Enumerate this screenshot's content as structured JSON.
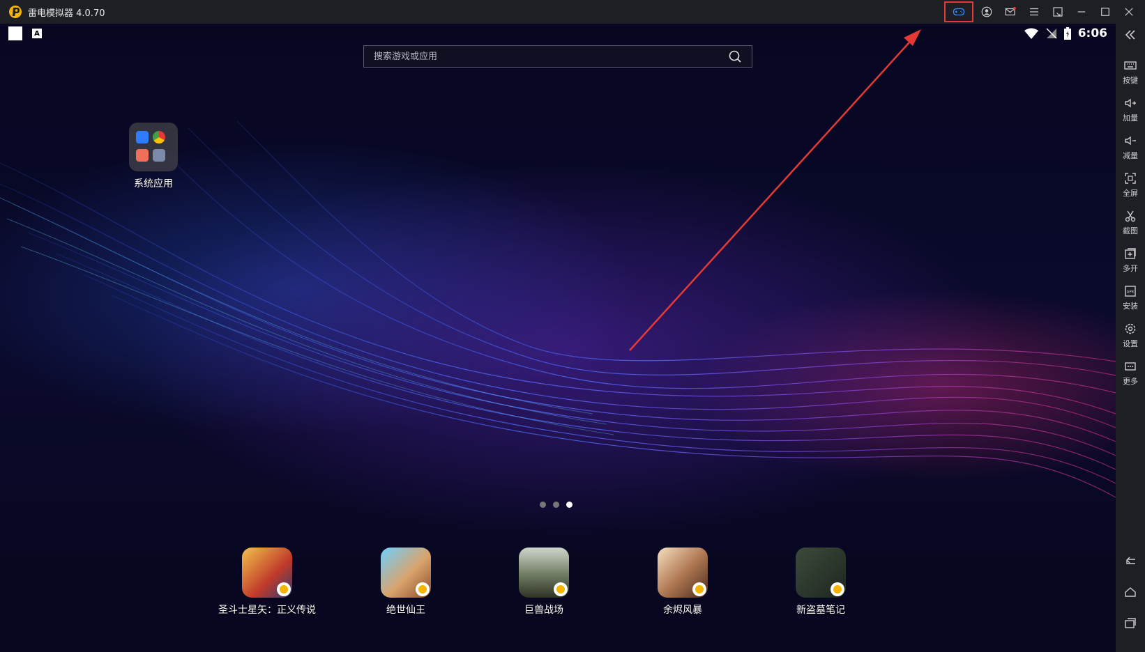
{
  "window": {
    "title": "雷电模拟器 4.0.70"
  },
  "colors": {
    "accent_highlight": "#e53935",
    "titlebar_bg": "#1e1f25",
    "logo": "#f5b400"
  },
  "titlebar_icons": [
    "gamepad-icon",
    "account-icon",
    "mail-icon",
    "menu-icon",
    "restore-icon",
    "minimize-icon",
    "maximize-icon",
    "close-icon"
  ],
  "status_bar": {
    "time": "6:06",
    "keyboard_badge": "A"
  },
  "search": {
    "placeholder": "搜索游戏或应用"
  },
  "desktop": {
    "folder_label": "系统应用"
  },
  "pager": {
    "count": 3,
    "active": 3
  },
  "dock": {
    "apps": [
      {
        "label": "圣斗士星矢：正义传说"
      },
      {
        "label": "绝世仙王"
      },
      {
        "label": "巨兽战场"
      },
      {
        "label": "余烬风暴"
      },
      {
        "label": "新盗墓笔记"
      }
    ]
  },
  "sidebar": {
    "items": [
      {
        "label": "按键",
        "icon": "keyboard-icon"
      },
      {
        "label": "加量",
        "icon": "volume-up-icon"
      },
      {
        "label": "减量",
        "icon": "volume-down-icon"
      },
      {
        "label": "全屏",
        "icon": "fullscreen-icon"
      },
      {
        "label": "截图",
        "icon": "scissors-icon"
      },
      {
        "label": "多开",
        "icon": "multi-instance-icon"
      },
      {
        "label": "安装",
        "icon": "apk-icon"
      },
      {
        "label": "设置",
        "icon": "gear-icon"
      },
      {
        "label": "更多",
        "icon": "more-icon"
      }
    ],
    "nav": [
      "back-icon",
      "home-icon",
      "recents-icon"
    ]
  }
}
